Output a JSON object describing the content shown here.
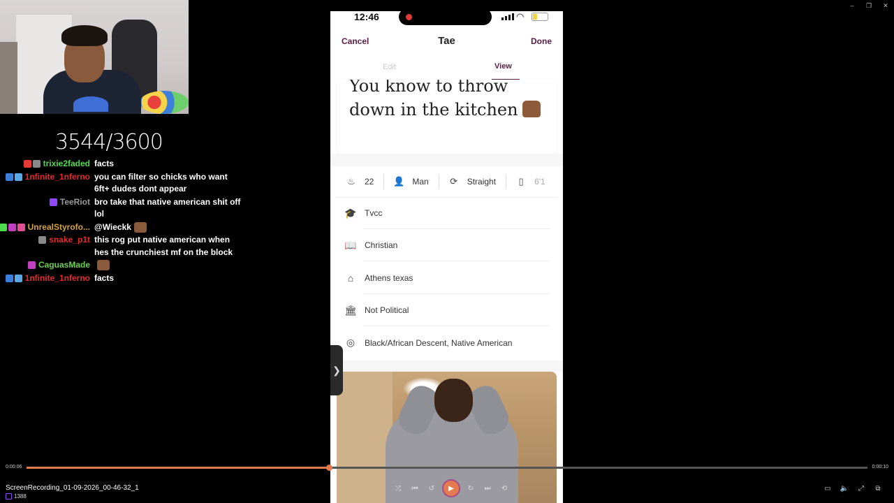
{
  "window": {
    "minimize": "–",
    "restore": "❐",
    "close": "✕"
  },
  "counter": "3544/3600",
  "chat": [
    {
      "user": "trixie2faded",
      "color": "#4ddb4d",
      "text": "facts",
      "badges": [
        "#e53935",
        "#888888"
      ]
    },
    {
      "user": "1nfinite_1nferno",
      "color": "#e52b2b",
      "text": "you can filter so chicks who want 6ft+ dudes dont appear",
      "badges": [
        "#3b7fd8",
        "#5aa9e6"
      ]
    },
    {
      "user": "TeeRiot",
      "color": "#9a9a9a",
      "text": "bro take that native american shit off lol",
      "badges": [
        "#9147ff"
      ]
    },
    {
      "user": "UnrealStyrofo...",
      "color": "#d6a23a",
      "text": "@Wieckk",
      "badges": [
        "#4ddb4d",
        "#c040c0",
        "#e05090"
      ],
      "emote": true
    },
    {
      "user": "snake_p1t",
      "color": "#e52b2b",
      "text": "this rog put native american when hes the crunchiest mf on the block",
      "badges": [
        "#888888"
      ]
    },
    {
      "user": "CaguasMade",
      "color": "#6ccf4a",
      "text": "",
      "badges": [
        "#c040c0"
      ],
      "emote": true
    },
    {
      "user": "1nfinite_1nferno",
      "color": "#e52b2b",
      "text": "facts",
      "badges": [
        "#3b7fd8",
        "#5aa9e6"
      ]
    }
  ],
  "phone": {
    "time": "12:46",
    "cancel": "Cancel",
    "name": "Tae",
    "done": "Done",
    "tab_edit": "Edit",
    "tab_view": "View",
    "prompt_answer": "You know to throw down in the kitchen",
    "vitals": {
      "age": "22",
      "gender": "Man",
      "orientation": "Straight",
      "height": "6'1"
    },
    "info": [
      {
        "icon": "school-icon",
        "glyph": "🎓",
        "label": "Tvcc"
      },
      {
        "icon": "religion-book-icon",
        "glyph": "📖",
        "label": "Christian"
      },
      {
        "icon": "home-icon",
        "glyph": "⌂",
        "label": "Athens texas"
      },
      {
        "icon": "politics-building-icon",
        "glyph": "🏛",
        "label": "Not Political"
      },
      {
        "icon": "ethnicity-globe-icon",
        "glyph": "◎",
        "label": "Black/African Descent, Native American"
      }
    ]
  },
  "side_handle": "❯",
  "player": {
    "time_start": "0:00:06",
    "time_end": "0:00:10",
    "progress": 0.36,
    "file_name": "ScreenRecording_01-09-2026_00-46-32_1",
    "viewers": "1388",
    "controls": {
      "shuffle": "⤮",
      "prev": "⏮",
      "back": "↺",
      "play": "▶",
      "forward": "↻",
      "next": "⏭",
      "repeat": "⟲"
    },
    "right_controls": {
      "subtitles": "▭",
      "volume": "🔈",
      "fullscreen": "⤢",
      "mini": "⧉"
    }
  }
}
